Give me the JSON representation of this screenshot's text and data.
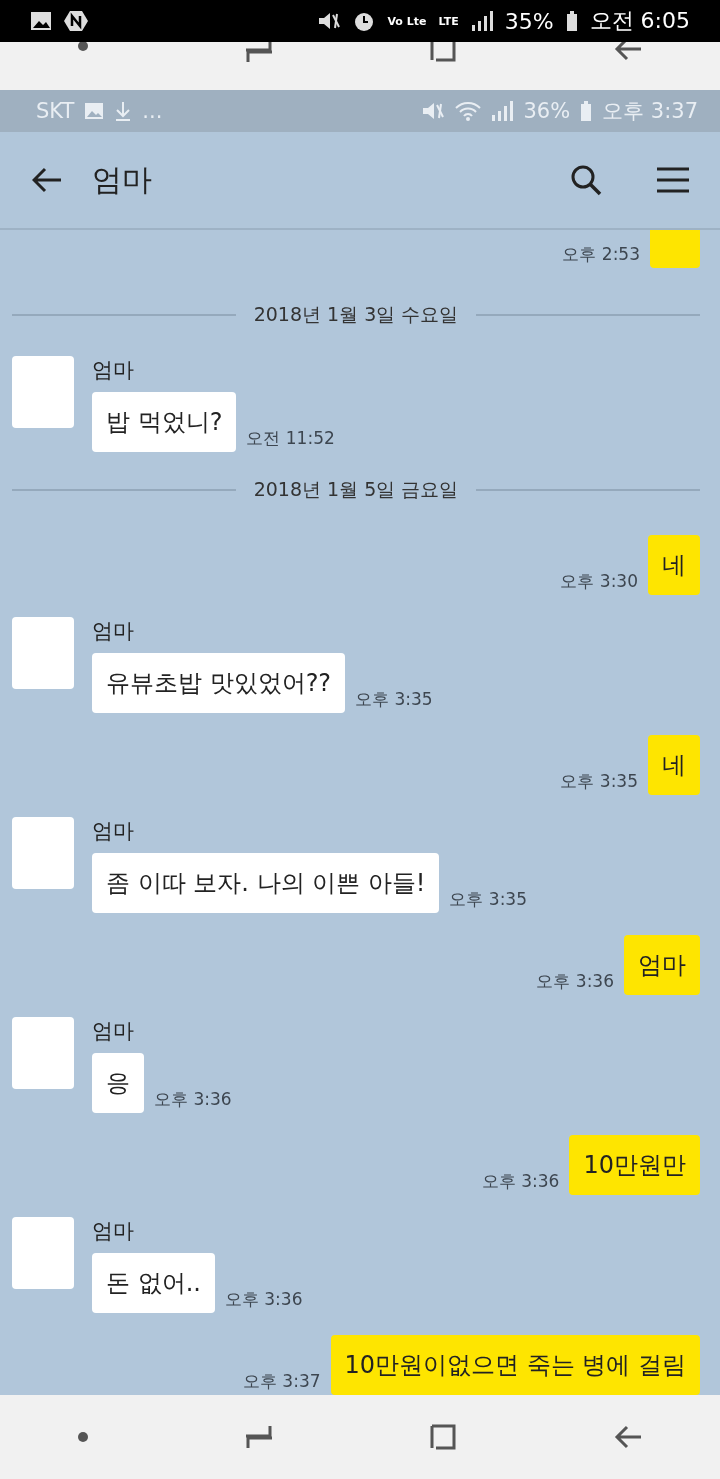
{
  "phone_status": {
    "volte": "Vo Lte",
    "network": "LTE",
    "battery": "35%",
    "time": "오전 6:05"
  },
  "inner_status": {
    "carrier": "SKT",
    "more": "...",
    "battery": "36%",
    "time": "오후 3:37"
  },
  "header": {
    "title": "엄마"
  },
  "messages": [
    {
      "kind": "mine",
      "time": "오후 2:53",
      "clipped": true
    },
    {
      "kind": "date",
      "text": "2018년 1월 3일 수요일"
    },
    {
      "kind": "theirs",
      "name": "엄마",
      "text": "밥 먹었니?",
      "time": "오전 11:52"
    },
    {
      "kind": "date",
      "text": "2018년 1월 5일 금요일"
    },
    {
      "kind": "mine",
      "text": "네",
      "time": "오후 3:30"
    },
    {
      "kind": "theirs",
      "name": "엄마",
      "text": "유뷰초밥 맛있었어??",
      "time": "오후 3:35"
    },
    {
      "kind": "mine",
      "text": "네",
      "time": "오후 3:35"
    },
    {
      "kind": "theirs",
      "name": "엄마",
      "text": "좀 이따 보자. 나의 이쁜 아들!",
      "time": "오후 3:35"
    },
    {
      "kind": "mine",
      "text": "엄마",
      "time": "오후 3:36"
    },
    {
      "kind": "theirs",
      "name": "엄마",
      "text": "응",
      "time": "오후 3:36"
    },
    {
      "kind": "mine",
      "text": "10만원만",
      "time": "오후 3:36"
    },
    {
      "kind": "theirs",
      "name": "엄마",
      "text": "돈 없어..",
      "time": "오후 3:36"
    },
    {
      "kind": "mine",
      "text": "10만원이없으면 죽는 병에 걸림",
      "time": "오후 3:37"
    }
  ]
}
